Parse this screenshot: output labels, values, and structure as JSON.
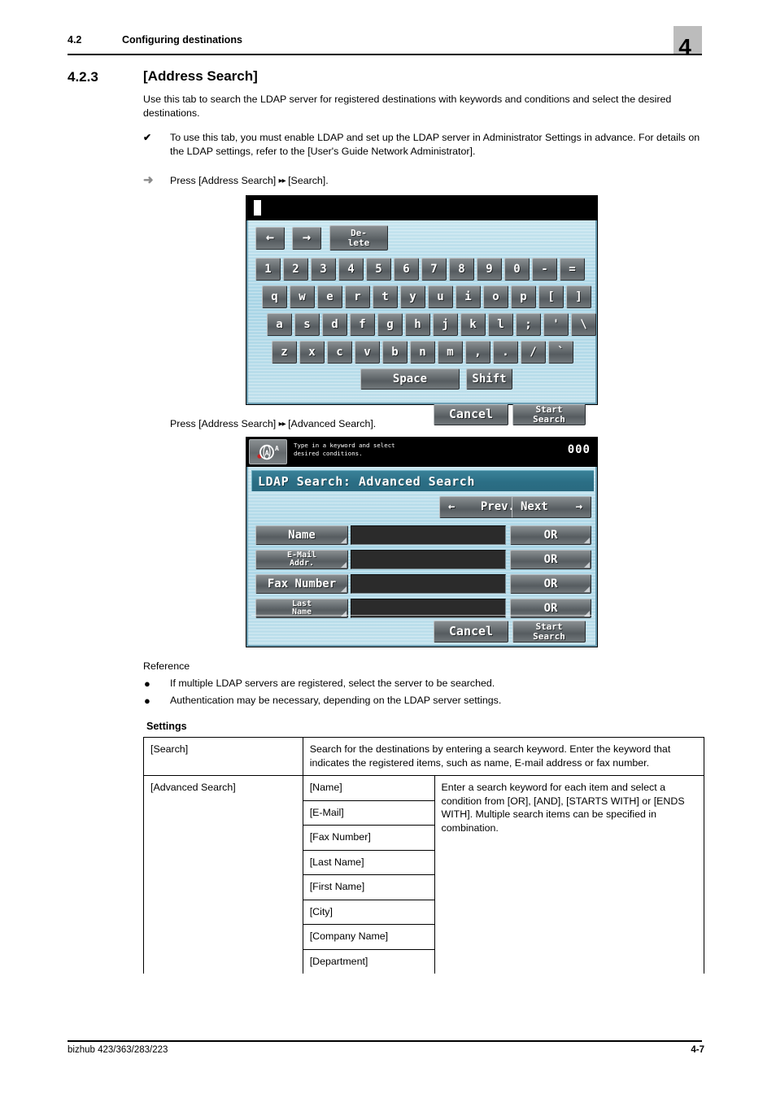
{
  "header": {
    "section_number": "4.2",
    "section_title": "Configuring destinations",
    "chapter_badge": "4"
  },
  "section": {
    "number": "4.2.3",
    "title": "[Address Search]",
    "intro": "Use this tab to search the LDAP server for registered destinations with keywords and conditions and select the desired destinations.",
    "note_mark": "✔",
    "note_text": "To use this tab, you must enable LDAP and set up the LDAP server in Administrator Settings in advance. For details on the LDAP settings, refer to the [User's Guide Network Administrator].",
    "step_arrow": "➜",
    "step1_a": "Press [Address Search]",
    "step1_arrows": "▸▸",
    "step1_b": "[Search].",
    "step2_a": "Press [Address Search]",
    "step2_arrows": "▸▸",
    "step2_b": "[Advanced Search]."
  },
  "reference": {
    "title": "Reference",
    "bullet": "●",
    "items": [
      "If multiple LDAP servers are registered, select the server to be searched.",
      "Authentication may be necessary, depending on the LDAP server settings."
    ]
  },
  "settings": {
    "heading": "Settings",
    "rows": [
      {
        "label": "[Search]",
        "description": "Search for the destinations by entering a search keyword. Enter the keyword that indicates the registered items, such as name, E-mail address or fax number."
      },
      {
        "label": "[Advanced Search]",
        "items": [
          "[Name]",
          "[E-Mail]",
          "[Fax Number]",
          "[Last Name]",
          "[First Name]",
          "[City]",
          "[Company Name]",
          "[Department]"
        ],
        "description": "Enter a search keyword for each item and select a condition from [OR], [AND], [STARTS WITH] or [ENDS WITH]. Multiple search items can be specified in combination."
      }
    ]
  },
  "footer": {
    "model": "bizhub 423/363/283/223",
    "page": "4-7"
  },
  "screen_keyboard": {
    "input_value": "",
    "nav": {
      "left_arrow": "←",
      "right_arrow": "→",
      "delete_line1": "De-",
      "delete_line2": "lete"
    },
    "rows": [
      [
        "1",
        "2",
        "3",
        "4",
        "5",
        "6",
        "7",
        "8",
        "9",
        "0",
        "-",
        "="
      ],
      [
        "q",
        "w",
        "e",
        "r",
        "t",
        "y",
        "u",
        "i",
        "o",
        "p",
        "[",
        "]"
      ],
      [
        "a",
        "s",
        "d",
        "f",
        "g",
        "h",
        "j",
        "k",
        "l",
        ";",
        "'",
        "\\"
      ],
      [
        "z",
        "x",
        "c",
        "v",
        "b",
        "n",
        "m",
        ",",
        ".",
        "/",
        "`"
      ]
    ],
    "space_label": "Space",
    "shift_label": "Shift",
    "cancel_label": "Cancel",
    "start_search_line1": "Start",
    "start_search_line2": "Search"
  },
  "screen_advanced": {
    "message_line1": "Type in a keyword and select",
    "message_line2": "desired conditions.",
    "counter": "000",
    "icon_name": "scan-mode-icon",
    "title": "LDAP Search: Advanced Search",
    "prev_arrow": "←",
    "prev_label": "Prev.",
    "next_label": "Next",
    "next_arrow": "→",
    "fields": [
      {
        "label_line1": "Name",
        "label_line2": "",
        "value": "",
        "condition": "OR"
      },
      {
        "label_line1": "E-Mail",
        "label_line2": "Addr.",
        "value": "",
        "condition": "OR"
      },
      {
        "label_line1": "Fax Number",
        "label_line2": "",
        "value": "",
        "condition": "OR"
      },
      {
        "label_line1": "Last",
        "label_line2": "Name",
        "value": "",
        "condition": "OR"
      }
    ],
    "cancel_label": "Cancel",
    "start_search_line1": "Start",
    "start_search_line2": "Search"
  },
  "colors": {
    "panel_blue": "#b6dce8",
    "title_teal": "#2b6e85",
    "key_gray": "#6e7477",
    "chapter_badge_gray": "#bcbcbc"
  }
}
